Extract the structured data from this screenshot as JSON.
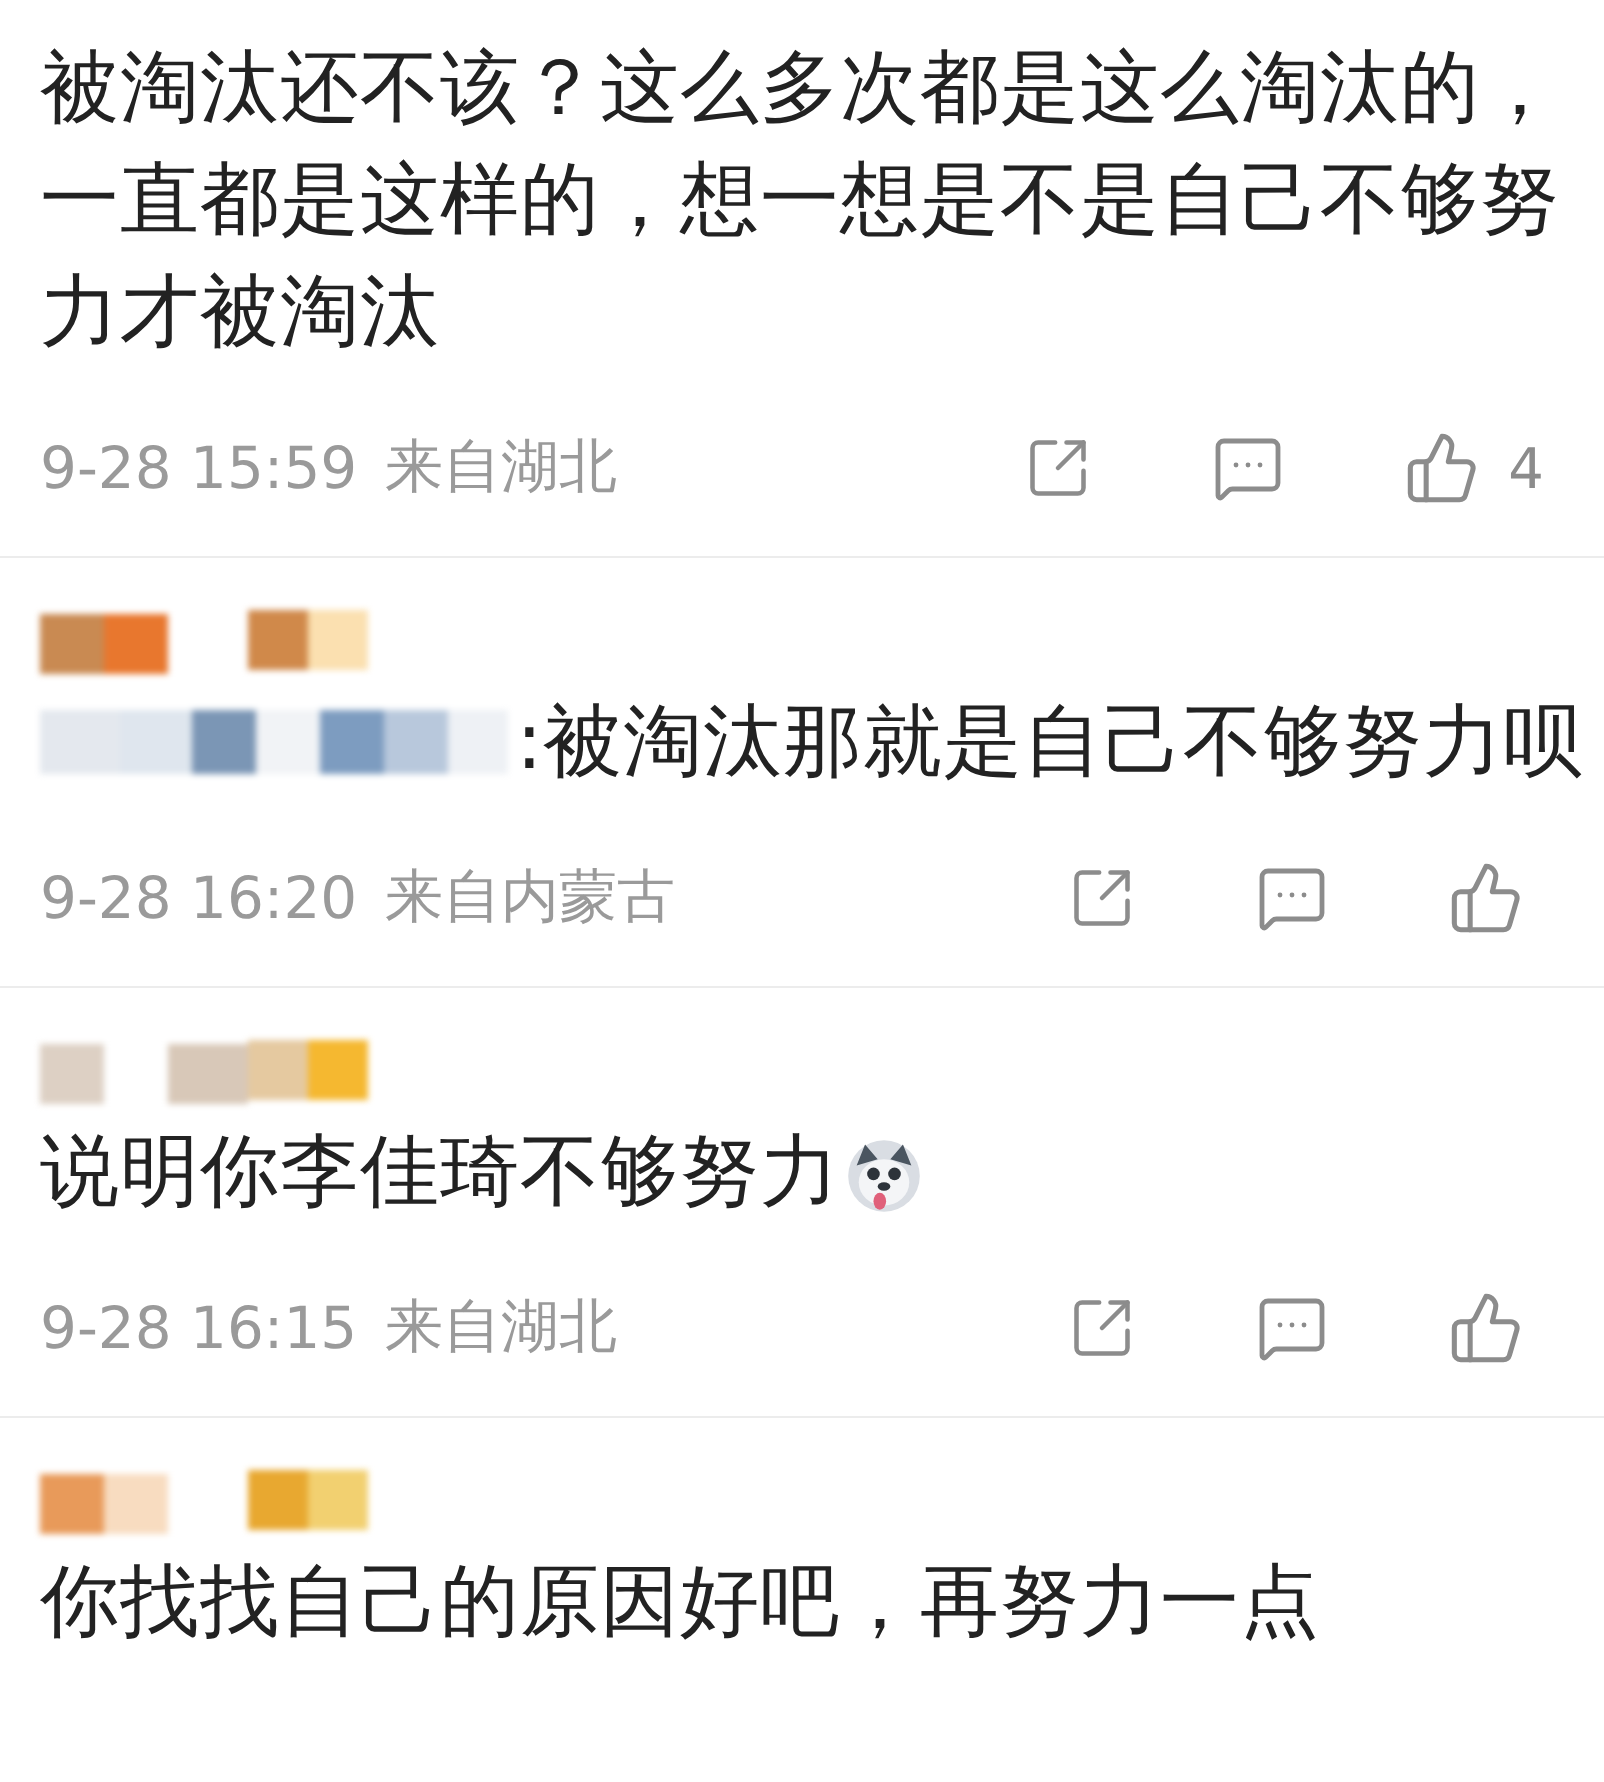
{
  "comments": [
    {
      "kind": "plain",
      "text": "被淘汰还不该？这么多次都是这么淘汰的，一直都是这样的，想一想是不是自己不够努力才被淘汰",
      "sticker": false,
      "time": "9-28 15:59",
      "location": "来自湖北",
      "likes": "4"
    },
    {
      "kind": "reply",
      "text": ":被淘汰那就是自己不够努力呗",
      "sticker": false,
      "time": "9-28 16:20",
      "location": "来自内蒙古"
    },
    {
      "kind": "plain",
      "text": "说明你李佳琦不够努力",
      "sticker": true,
      "time": "9-28 16:15",
      "location": "来自湖北"
    },
    {
      "kind": "plain",
      "text": "你找找自己的原因好吧，再努力一点",
      "sticker": false
    }
  ]
}
